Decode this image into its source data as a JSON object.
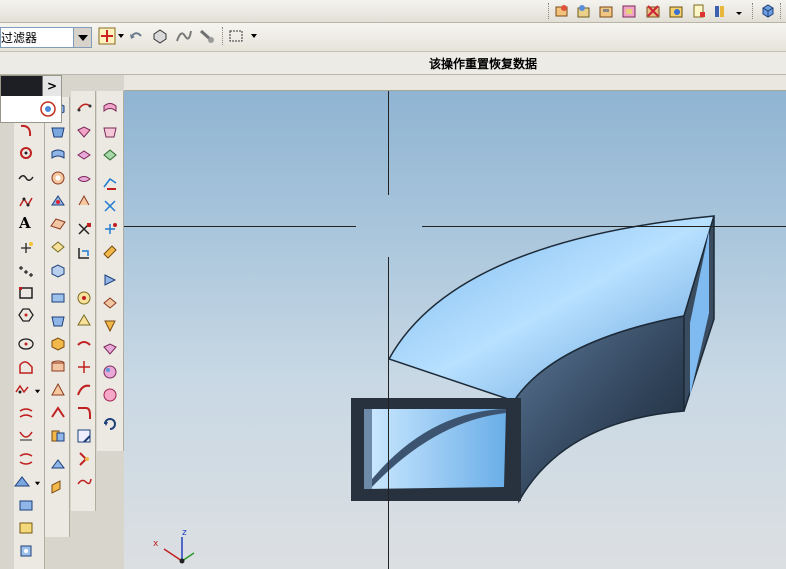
{
  "toolbar_top": {
    "icons": [
      "part-icon",
      "open-icon",
      "save-icon",
      "assembly-icon",
      "cut-icon",
      "render-icon",
      "doc-icon",
      "flag-icon",
      "dropdown-icon",
      "cube-icon"
    ]
  },
  "selection_bar": {
    "filter_value": "过滤器",
    "icons": [
      "snap-point-icon",
      "undo-arrow-icon",
      "select-object-icon",
      "wave-icon",
      "wrench-icon",
      "box-select-icon"
    ]
  },
  "status": {
    "message": "该操作重置恢复数据"
  },
  "resource_bar": {
    "expand_glyph": ">"
  },
  "palette": {
    "curve_tools": [
      "arc-icon",
      "circle-point-icon",
      "spline-icon",
      "point-set-icon",
      "text-icon",
      "point-icon",
      "points-icon",
      "rectangle-icon",
      "polygon-icon",
      "ellipse-icon",
      "shape-icon",
      "offset-icon",
      "join-icon",
      "bridge-icon",
      "project-icon",
      "extract-icon",
      "wrap-icon",
      "layer-icon",
      "sheet-icon"
    ],
    "text_tool_label": "A",
    "datum_label": "x"
  },
  "viewport": {
    "triad": {
      "x_label": "x",
      "z_label": "z"
    },
    "colors": {
      "model_light": "#88c4f5",
      "model_dark": "#2a3440",
      "background_top": "#8fb4d2"
    }
  }
}
